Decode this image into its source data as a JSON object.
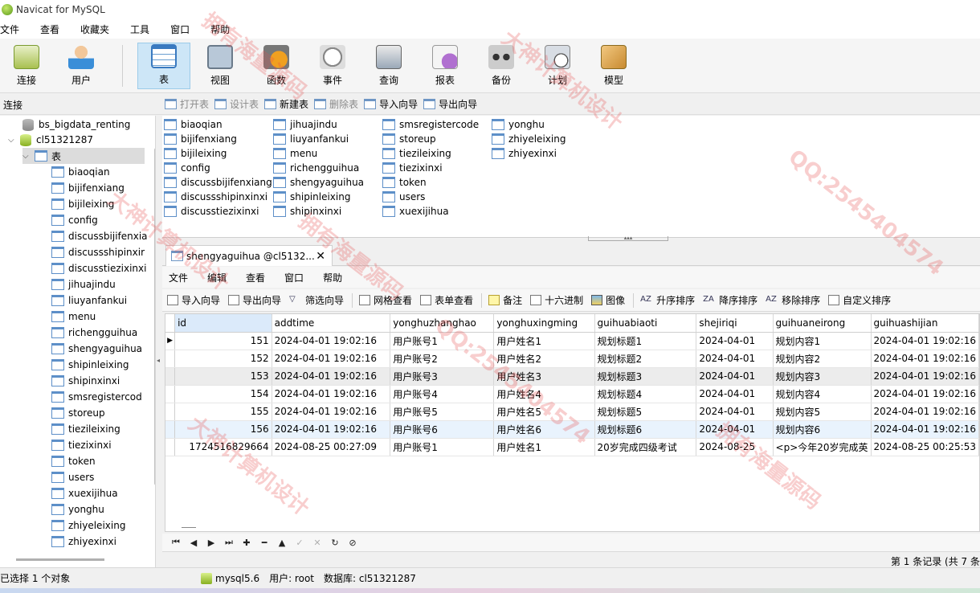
{
  "window": {
    "title": "Navicat for MySQL"
  },
  "menubar": {
    "items": [
      "文件",
      "查看",
      "收藏夹",
      "工具",
      "窗口",
      "帮助"
    ]
  },
  "toolbar": {
    "buttons": [
      {
        "label": "连接",
        "icon": "connect-icon"
      },
      {
        "label": "用户",
        "icon": "user-icon"
      },
      {
        "label": "表",
        "icon": "table-icon",
        "active": true
      },
      {
        "label": "视图",
        "icon": "view-icon"
      },
      {
        "label": "函数",
        "icon": "function-icon"
      },
      {
        "label": "事件",
        "icon": "event-icon"
      },
      {
        "label": "查询",
        "icon": "query-icon"
      },
      {
        "label": "报表",
        "icon": "report-icon"
      },
      {
        "label": "备份",
        "icon": "backup-icon"
      },
      {
        "label": "计划",
        "icon": "schedule-icon"
      },
      {
        "label": "模型",
        "icon": "model-icon"
      }
    ]
  },
  "subheader": {
    "connection_label": "连接",
    "object_tools": [
      {
        "label": "打开表",
        "enabled": false
      },
      {
        "label": "设计表",
        "enabled": false
      },
      {
        "label": "新建表",
        "enabled": true
      },
      {
        "label": "删除表",
        "enabled": false
      },
      {
        "label": "导入向导",
        "enabled": true
      },
      {
        "label": "导出向导",
        "enabled": true
      }
    ]
  },
  "sidebar": {
    "connections": [
      "bs_bigdata_renting",
      "cl51321287"
    ],
    "tables_folder": "表",
    "tables": [
      "biaoqian",
      "bijifenxiang",
      "bijileixing",
      "config",
      "discussbijifenxia",
      "discussshipinxir",
      "discusstiezixinxi",
      "jihuajindu",
      "liuyanfankui",
      "menu",
      "richengguihua",
      "shengyaguihua",
      "shipinleixing",
      "shipinxinxi",
      "smsregistercod",
      "storeup",
      "tiezileixing",
      "tiezixinxi",
      "token",
      "users",
      "xuexijihua",
      "yonghu",
      "zhiyeleixing",
      "zhiyexinxi"
    ]
  },
  "object_list": {
    "columns": [
      [
        "biaoqian",
        "bijifenxiang",
        "bijileixing",
        "config",
        "discussbijifenxiang",
        "discussshipinxinxi",
        "discusstiezixinxi"
      ],
      [
        "jihuajindu",
        "liuyanfankui",
        "menu",
        "richengguihua",
        "shengyaguihua",
        "shipinleixing",
        "shipinxinxi"
      ],
      [
        "smsregistercode",
        "storeup",
        "tiezileixing",
        "tiezixinxi",
        "token",
        "users",
        "xuexijihua"
      ],
      [
        "yonghu",
        "zhiyeleixing",
        "zhiyexinxi"
      ]
    ]
  },
  "tab": {
    "label": "shengyaguihua @cl5132...",
    "close": "✕"
  },
  "tab_menu": {
    "items": [
      "文件",
      "编辑",
      "查看",
      "窗口",
      "帮助"
    ]
  },
  "grid_tools": [
    {
      "label": "导入向导",
      "icon": "import-icon"
    },
    {
      "label": "导出向导",
      "icon": "export-icon"
    },
    {
      "label": "筛选向导",
      "icon": "filter-icon"
    },
    {
      "label": "网格查看",
      "icon": "grid-view-icon"
    },
    {
      "label": "表单查看",
      "icon": "form-view-icon"
    },
    {
      "label": "备注",
      "icon": "note-icon"
    },
    {
      "label": "十六进制",
      "icon": "hex-icon"
    },
    {
      "label": "图像",
      "icon": "image-icon"
    },
    {
      "label": "升序排序",
      "icon": "sort-asc-icon"
    },
    {
      "label": "降序排序",
      "icon": "sort-desc-icon"
    },
    {
      "label": "移除排序",
      "icon": "remove-sort-icon"
    },
    {
      "label": "自定义排序",
      "icon": "custom-sort-icon"
    }
  ],
  "grid": {
    "columns": [
      "id",
      "addtime",
      "yonghuzhanghao",
      "yonghuxingming",
      "guihuabiaoti",
      "shejiriqi",
      "guihuaneirong",
      "guihuashijian"
    ],
    "rows": [
      [
        "151",
        "2024-04-01 19:02:16",
        "用户账号1",
        "用户姓名1",
        "规划标题1",
        "2024-04-01",
        "规划内容1",
        "2024-04-01 19:02:16"
      ],
      [
        "152",
        "2024-04-01 19:02:16",
        "用户账号2",
        "用户姓名2",
        "规划标题2",
        "2024-04-01",
        "规划内容2",
        "2024-04-01 19:02:16"
      ],
      [
        "153",
        "2024-04-01 19:02:16",
        "用户账号3",
        "用户姓名3",
        "规划标题3",
        "2024-04-01",
        "规划内容3",
        "2024-04-01 19:02:16"
      ],
      [
        "154",
        "2024-04-01 19:02:16",
        "用户账号4",
        "用户姓名4",
        "规划标题4",
        "2024-04-01",
        "规划内容4",
        "2024-04-01 19:02:16"
      ],
      [
        "155",
        "2024-04-01 19:02:16",
        "用户账号5",
        "用户姓名5",
        "规划标题5",
        "2024-04-01",
        "规划内容5",
        "2024-04-01 19:02:16"
      ],
      [
        "156",
        "2024-04-01 19:02:16",
        "用户账号6",
        "用户姓名6",
        "规划标题6",
        "2024-04-01",
        "规划内容6",
        "2024-04-01 19:02:16"
      ],
      [
        "1724516829664",
        "2024-08-25 00:27:09",
        "用户账号1",
        "用户姓名1",
        "20岁完成四级考试",
        "2024-08-25",
        "<p>今年20岁完成英",
        "2024-08-25 00:25:53"
      ]
    ]
  },
  "pagination": {
    "info": "第 1 条记录 (共 7 条"
  },
  "statusbar": {
    "selection": "已选择 1 个对象",
    "server": "mysql5.6",
    "user": "用户: root",
    "database": "数据库: cl51321287"
  },
  "watermarks": [
    "拥有海量源码",
    "大神计算机设计",
    "QQ:2545404574",
    "拥有海量源码",
    "大神计算机设计",
    "QQ:2545404574",
    "拥有海量源码",
    "大神计算机设计"
  ]
}
